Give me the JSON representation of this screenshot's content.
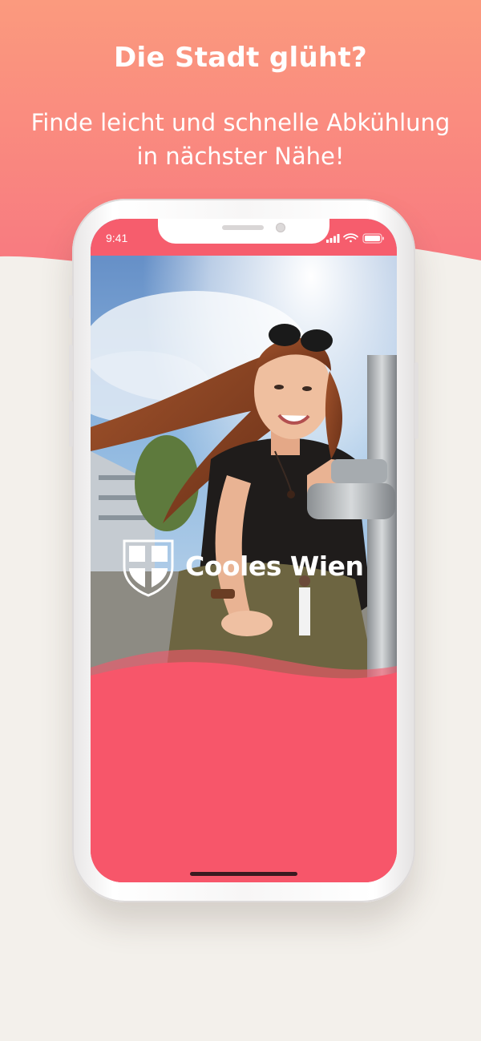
{
  "promo": {
    "headline": "Die Stadt glüht?",
    "subline_line1": "Finde leicht und schnelle Abkühlung",
    "subline_line2": "in nächster Nähe!"
  },
  "status_bar": {
    "time": "9:41",
    "signal_icon": "cellular-signal-icon",
    "wifi_icon": "wifi-icon",
    "battery_icon": "battery-icon"
  },
  "splash": {
    "app_name": "Cooles Wien",
    "logo_icon": "vienna-shield-icon",
    "background_color": "#f7566a"
  },
  "colors": {
    "gradient_top": "#fb9a7e",
    "gradient_bottom": "#f87c7f",
    "page_background": "#f3f0eb",
    "accent": "#f7566a"
  }
}
